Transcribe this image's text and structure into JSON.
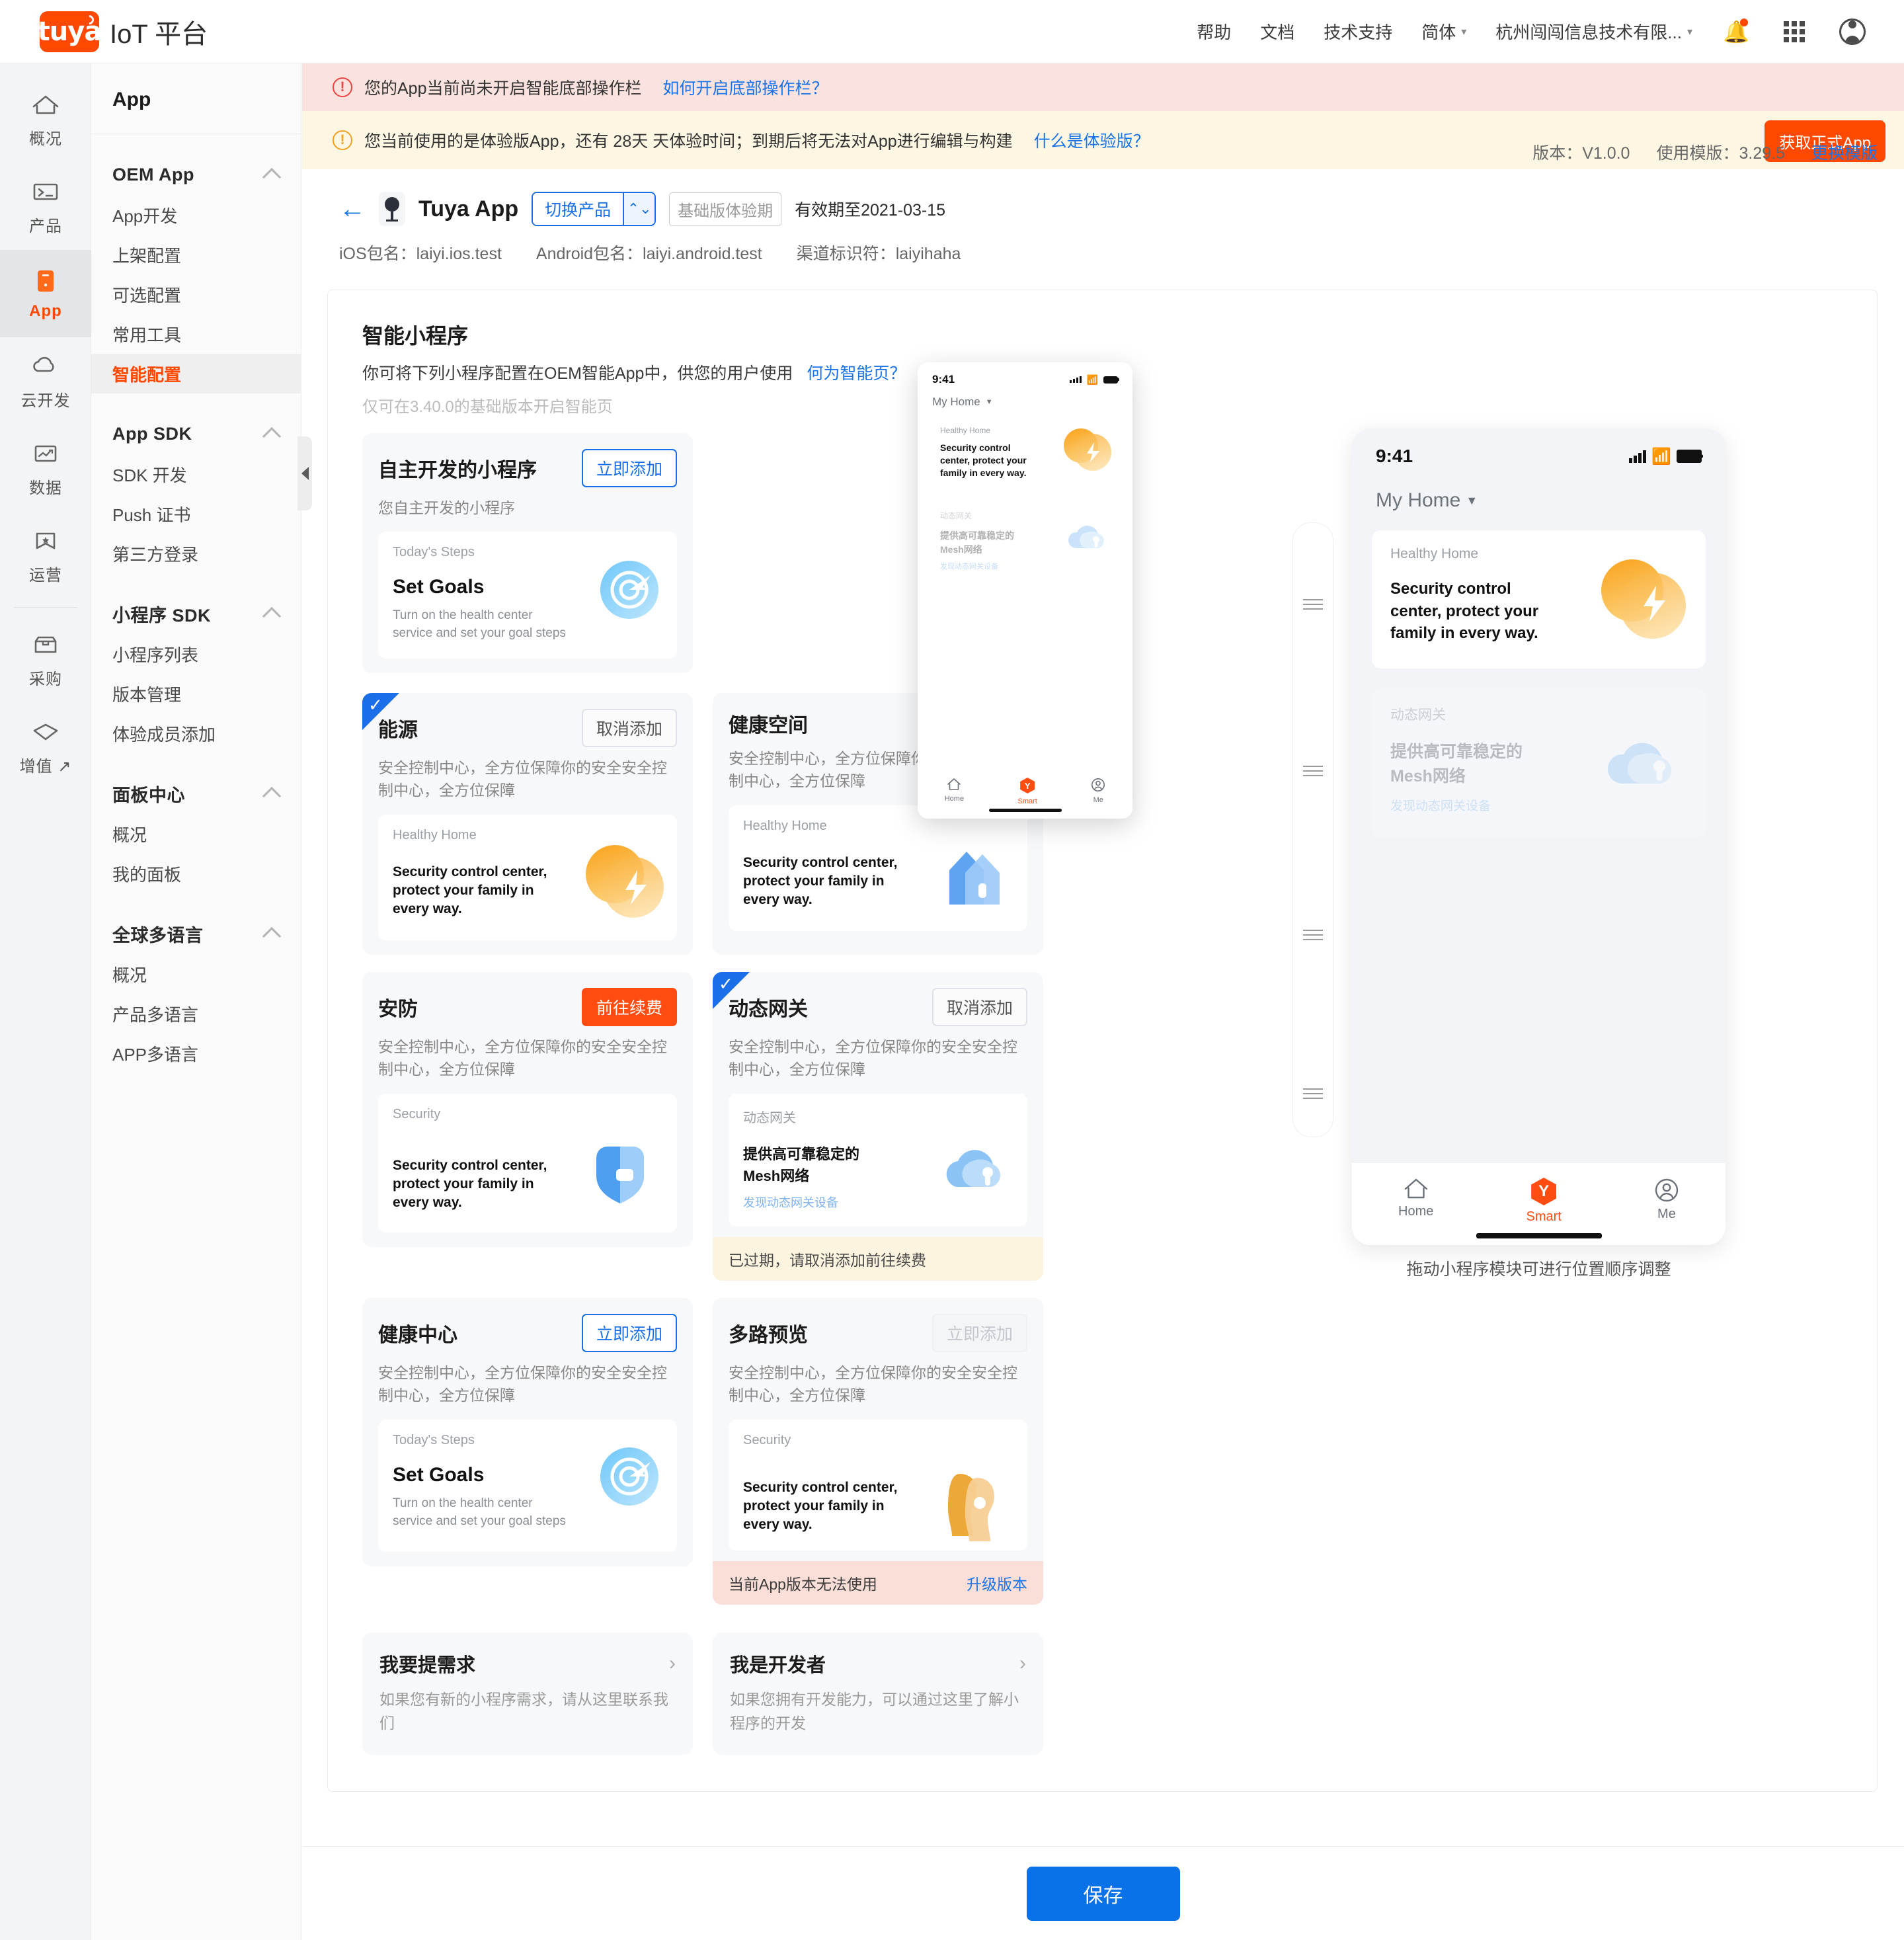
{
  "header": {
    "logo_text": "IoT 平台",
    "logo_mark": "tuya",
    "nav": [
      {
        "label": "帮助",
        "caret": false
      },
      {
        "label": "文档",
        "caret": false
      },
      {
        "label": "技术支持",
        "caret": false
      },
      {
        "label": "简体",
        "caret": true
      },
      {
        "label": "杭州闯闯信息技术有限...",
        "caret": true
      }
    ],
    "bell_icon": "notification-bell-icon",
    "apps_icon": "app-grid-icon",
    "avatar_icon": "user-avatar-icon"
  },
  "rail": [
    {
      "label": "概况",
      "icon": "home-icon",
      "active": false
    },
    {
      "label": "产品",
      "icon": "terminal-icon",
      "active": false
    },
    {
      "label": "App",
      "icon": "app-icon",
      "active": true
    },
    {
      "label": "云开发",
      "icon": "cloud-icon",
      "active": false
    },
    {
      "label": "数据",
      "icon": "chart-icon",
      "active": false
    },
    {
      "label": "运营",
      "icon": "flag-star-icon",
      "active": false
    },
    {
      "label": "采购",
      "icon": "box-icon",
      "active": false
    },
    {
      "label": "增值 ↗",
      "icon": "diamond-icon",
      "active": false
    }
  ],
  "subnav": {
    "title": "App",
    "groups": [
      {
        "title": "OEM App",
        "items": [
          {
            "label": "App开发",
            "active": false
          },
          {
            "label": "上架配置",
            "active": false
          },
          {
            "label": "可选配置",
            "active": false
          },
          {
            "label": "常用工具",
            "active": false
          },
          {
            "label": "智能配置",
            "active": true
          }
        ]
      },
      {
        "title": "App SDK",
        "items": [
          {
            "label": "SDK 开发",
            "active": false
          },
          {
            "label": "Push 证书",
            "active": false
          },
          {
            "label": "第三方登录",
            "active": false
          }
        ]
      },
      {
        "title": "小程序 SDK",
        "items": [
          {
            "label": "小程序列表",
            "active": false
          },
          {
            "label": "版本管理",
            "active": false
          },
          {
            "label": "体验成员添加",
            "active": false
          }
        ]
      },
      {
        "title": "面板中心",
        "items": [
          {
            "label": "概况",
            "active": false
          },
          {
            "label": "我的面板",
            "active": false
          }
        ]
      },
      {
        "title": "全球多语言",
        "items": [
          {
            "label": "概况",
            "active": false
          },
          {
            "label": "产品多语言",
            "active": false
          },
          {
            "label": "APP多语言",
            "active": false
          }
        ]
      }
    ]
  },
  "alerts": [
    {
      "type": "red",
      "icon": "warning-circle-icon",
      "text": "您的App当前尚未开启智能底部操作栏",
      "link": "如何开启底部操作栏？",
      "action": null
    },
    {
      "type": "yellow",
      "icon": "warning-circle-icon",
      "text": "您当前使用的是体验版App，还有 28天 天体验时间；到期后将无法对App进行编辑与构建",
      "link": "什么是体验版？",
      "action": "获取正式App"
    }
  ],
  "appbar": {
    "back_icon": "back-arrow-icon",
    "app_icon": "camera-device-icon",
    "app_name": "Tuya App",
    "switch_product_label": "切换产品",
    "switch_product_icon": "chevron-updown-icon",
    "badge": "基础版体验期",
    "valid_until": "有效期至2021-03-15",
    "ios_package": "iOS包名：laiyi.ios.test",
    "android_package": "Android包名：laiyi.android.test",
    "channel_id": "渠道标识符：laiyihaha",
    "version": "版本：V1.0.0",
    "template": "使用模版：3.29.5",
    "change_template": "更换模版"
  },
  "panel": {
    "title": "智能小程序",
    "subtitle": "你可将下列小程序配置在OEM智能App中，供您的用户使用",
    "subtitle_link": "何为智能页？",
    "note": "仅可在3.40.0的基础版本开启智能页"
  },
  "self_dev_card": {
    "title": "自主开发的小程序",
    "button": "立即添加",
    "desc": "您自主开发的小程序",
    "preview": {
      "kicker": "Today's Steps",
      "heading": "Set Goals",
      "sub": "Turn on the health center service and set your goal steps",
      "art": "target-icon"
    }
  },
  "mini_apps": [
    {
      "title": "能源",
      "button": "取消添加",
      "button_style": "grey",
      "checked": true,
      "desc": "安全控制中心，全方位保障你的安全安全控制中心，全方位保障",
      "preview": {
        "kicker": "Healthy Home",
        "body": "Security control center, protect your family in every way.",
        "art": "lightning-orange-icon"
      },
      "footer": null
    },
    {
      "title": "健康空间",
      "button": null,
      "button_style": null,
      "checked": false,
      "desc": "安全控制中心，全方位保障你的安全安全控制中心，全方位保障",
      "preview": {
        "kicker": "Healthy Home",
        "body": "Security control center, protect your family in every way.",
        "art": "house-blue-icon"
      },
      "footer": null
    },
    {
      "title": "安防",
      "button": "前往续费",
      "button_style": "orange",
      "checked": false,
      "desc": "安全控制中心，全方位保障你的安全安全控制中心，全方位保障",
      "preview": {
        "kicker": "Security",
        "body": "Security control center, protect your family in every way.",
        "art": "shield-camera-icon"
      },
      "footer": null
    },
    {
      "title": "动态网关",
      "button": "取消添加",
      "button_style": "grey",
      "checked": true,
      "desc": "安全控制中心，全方位保障你的安全安全控制中心，全方位保障",
      "preview": {
        "kicker": "动态网关",
        "body_cn": "提供高可靠稳定的\nMesh网络",
        "link": "发现动态网关设备",
        "art": "cloud-pin-icon"
      },
      "footer": {
        "style": "amber",
        "text": "已过期，请取消添加前往续费",
        "link": null
      }
    },
    {
      "title": "健康中心",
      "button": "立即添加",
      "button_style": "outline",
      "checked": false,
      "desc": "安全控制中心，全方位保障你的安全安全控制中心，全方位保障",
      "preview": {
        "kicker": "Today's Steps",
        "heading": "Set Goals",
        "sub": "Turn on the health center service and set your goal steps",
        "art": "target-icon"
      },
      "footer": null
    },
    {
      "title": "多路预览",
      "button": "立即添加",
      "button_style": "disabled",
      "checked": false,
      "desc": "安全控制中心，全方位保障你的安全安全控制中心，全方位保障",
      "preview": {
        "kicker": "Security",
        "body": "Security control center, protect your family in every way.",
        "art": "person-orange-icon"
      },
      "footer": {
        "style": "red",
        "text": "当前App版本无法使用",
        "link": "升级版本"
      }
    }
  ],
  "link_cards": [
    {
      "title": "我要提需求",
      "desc": "如果您有新的小程序需求，请从这里联系我们",
      "chevron": "chevron-right-icon"
    },
    {
      "title": "我是开发者",
      "desc": "如果您拥有开发能力，可以通过这里了解小程序的开发",
      "chevron": "chevron-right-icon"
    }
  ],
  "phone": {
    "status_time": "9:41",
    "home_label": "My Home",
    "card1": {
      "kicker": "Healthy Home",
      "body": "Security control center, protect your family in every way."
    },
    "card2": {
      "kicker": "动态网关",
      "body": "提供高可靠稳定的\nMesh网络",
      "link": "发现动态网关设备"
    },
    "nav": [
      {
        "label": "Home",
        "icon": "home-outline-icon",
        "active": false
      },
      {
        "label": "Smart",
        "icon": "tuya-hex-icon",
        "active": true
      },
      {
        "label": "Me",
        "icon": "person-circle-icon",
        "active": false
      }
    ],
    "caption": "拖动小程序模块可进行位置顺序调整"
  },
  "footer": {
    "save_label": "保存"
  },
  "colors": {
    "brand_orange": "#ff4800",
    "link_blue": "#1a73e8",
    "primary_blue": "#0a72e8",
    "alert_red_bg": "#fae2de",
    "alert_yellow_bg": "#fdf6e3"
  }
}
